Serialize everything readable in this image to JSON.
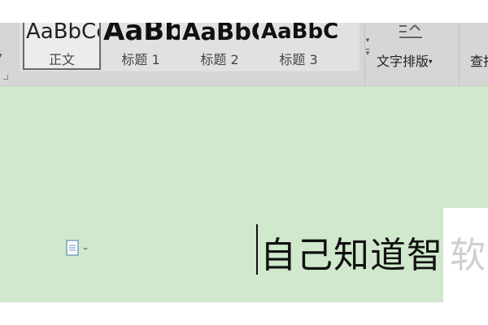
{
  "ribbon": {
    "styles": [
      {
        "preview": "AaBbCcDd",
        "label": "正文",
        "selected": true
      },
      {
        "preview": "AaBb",
        "label": "标题 1",
        "selected": false
      },
      {
        "preview": "AaBbC",
        "label": "标题 2",
        "selected": false
      },
      {
        "preview": "AaBbCcI",
        "label": "标题 3",
        "selected": false
      }
    ],
    "text_layout_label": "文字排版",
    "find_label": "查找"
  },
  "document": {
    "text": "自己知道智",
    "ghost_text": "软"
  },
  "icons": {
    "layout": "text-layout-icon",
    "paste": "paste-options-icon",
    "scroll": "chevron-down-icon"
  }
}
